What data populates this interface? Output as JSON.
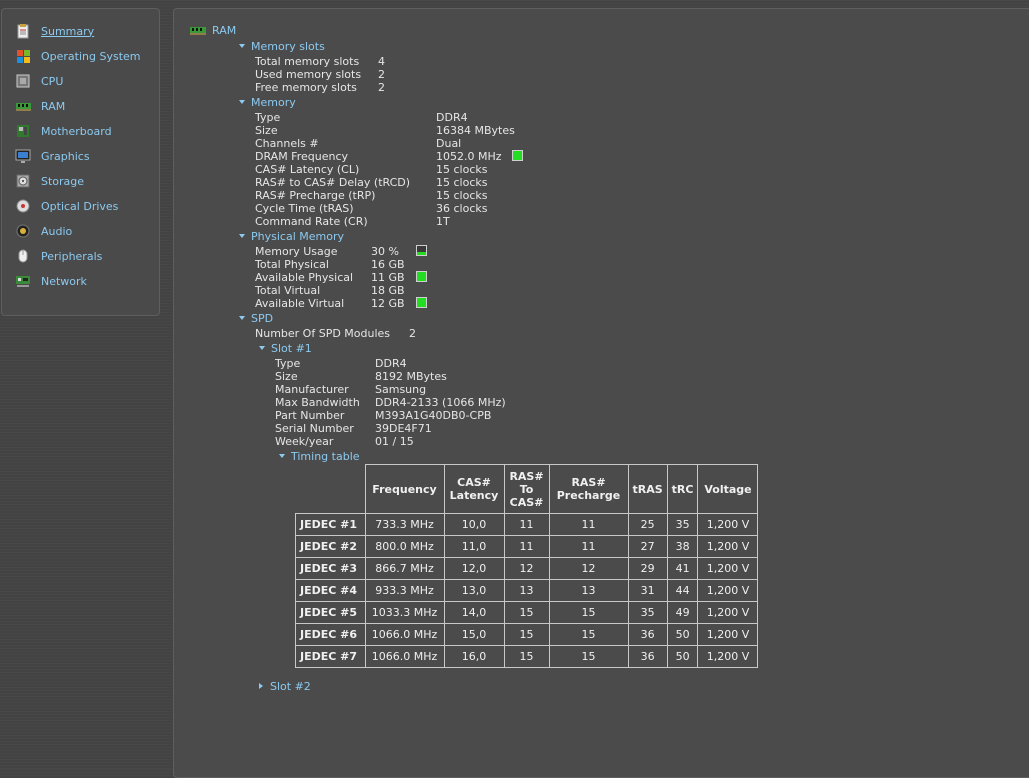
{
  "sidebar": {
    "items": [
      {
        "label": "Summary",
        "icon": "summary-icon"
      },
      {
        "label": "Operating System",
        "icon": "windows-icon"
      },
      {
        "label": "CPU",
        "icon": "cpu-icon"
      },
      {
        "label": "RAM",
        "icon": "ram-icon"
      },
      {
        "label": "Motherboard",
        "icon": "motherboard-icon"
      },
      {
        "label": "Graphics",
        "icon": "monitor-icon"
      },
      {
        "label": "Storage",
        "icon": "hdd-icon"
      },
      {
        "label": "Optical Drives",
        "icon": "disc-icon"
      },
      {
        "label": "Audio",
        "icon": "speaker-icon"
      },
      {
        "label": "Peripherals",
        "icon": "mouse-icon"
      },
      {
        "label": "Network",
        "icon": "network-icon"
      }
    ]
  },
  "main": {
    "title": "RAM",
    "memory_slots": {
      "title": "Memory slots",
      "rows": [
        {
          "label": "Total memory slots",
          "value": "4"
        },
        {
          "label": "Used memory slots",
          "value": "2"
        },
        {
          "label": "Free memory slots",
          "value": "2"
        }
      ]
    },
    "memory": {
      "title": "Memory",
      "rows": [
        {
          "label": "Type",
          "value": "DDR4"
        },
        {
          "label": "Size",
          "value": "16384 MBytes"
        },
        {
          "label": "Channels #",
          "value": "Dual"
        },
        {
          "label": "DRAM Frequency",
          "value": "1052.0 MHz"
        },
        {
          "label": "CAS# Latency (CL)",
          "value": "15 clocks"
        },
        {
          "label": "RAS# to CAS# Delay (tRCD)",
          "value": "15 clocks"
        },
        {
          "label": "RAS# Precharge (tRP)",
          "value": "15 clocks"
        },
        {
          "label": "Cycle Time (tRAS)",
          "value": "36 clocks"
        },
        {
          "label": "Command Rate (CR)",
          "value": "1T"
        }
      ]
    },
    "physical_memory": {
      "title": "Physical Memory",
      "rows": [
        {
          "label": "Memory Usage",
          "value": "30 %"
        },
        {
          "label": "Total Physical",
          "value": "16 GB"
        },
        {
          "label": "Available Physical",
          "value": "11 GB"
        },
        {
          "label": "Total Virtual",
          "value": "18 GB"
        },
        {
          "label": "Available Virtual",
          "value": "12 GB"
        }
      ]
    },
    "spd": {
      "title": "SPD",
      "modules_label": "Number Of SPD Modules",
      "modules_value": "2",
      "slot1": {
        "title": "Slot #1",
        "rows": [
          {
            "label": "Type",
            "value": "DDR4"
          },
          {
            "label": "Size",
            "value": "8192 MBytes"
          },
          {
            "label": "Manufacturer",
            "value": "Samsung"
          },
          {
            "label": "Max Bandwidth",
            "value": "DDR4-2133 (1066 MHz)"
          },
          {
            "label": "Part Number",
            "value": "M393A1G40DB0-CPB"
          },
          {
            "label": "Serial Number",
            "value": "39DE4F71"
          },
          {
            "label": "Week/year",
            "value": "01 / 15"
          }
        ],
        "timing_title": "Timing table",
        "timing_headers": [
          "Frequency",
          "CAS#\nLatency",
          "RAS#\nTo\nCAS#",
          "RAS#\nPrecharge",
          "tRAS",
          "tRC",
          "Voltage"
        ],
        "timing_rows": [
          [
            "JEDEC #1",
            "733.3 MHz",
            "10,0",
            "11",
            "11",
            "25",
            "35",
            "1,200 V"
          ],
          [
            "JEDEC #2",
            "800.0 MHz",
            "11,0",
            "11",
            "11",
            "27",
            "38",
            "1,200 V"
          ],
          [
            "JEDEC #3",
            "866.7 MHz",
            "12,0",
            "12",
            "12",
            "29",
            "41",
            "1,200 V"
          ],
          [
            "JEDEC #4",
            "933.3 MHz",
            "13,0",
            "13",
            "13",
            "31",
            "44",
            "1,200 V"
          ],
          [
            "JEDEC #5",
            "1033.3 MHz",
            "14,0",
            "15",
            "15",
            "35",
            "49",
            "1,200 V"
          ],
          [
            "JEDEC #6",
            "1066.0 MHz",
            "15,0",
            "15",
            "15",
            "36",
            "50",
            "1,200 V"
          ],
          [
            "JEDEC #7",
            "1066.0 MHz",
            "16,0",
            "15",
            "15",
            "36",
            "50",
            "1,200 V"
          ]
        ]
      },
      "slot2": {
        "title": "Slot #2"
      }
    }
  }
}
